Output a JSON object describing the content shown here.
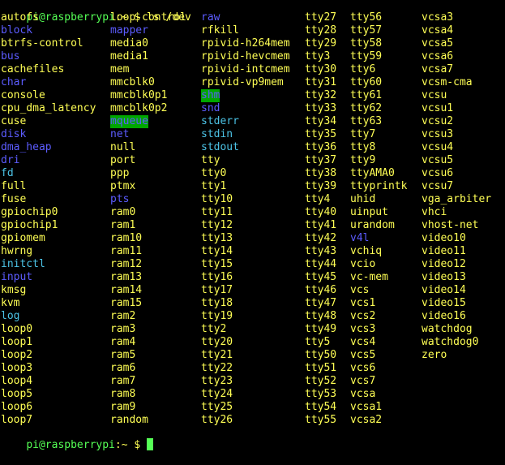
{
  "terminal": {
    "prompt": {
      "user_host": "pi@raspberrypi",
      "separator": ":",
      "path": "~",
      "symbol": "$"
    },
    "command": "ls /dev",
    "columns": [
      [
        {
          "name": "autofs",
          "kind": "f"
        },
        {
          "name": "block",
          "kind": "d"
        },
        {
          "name": "btrfs-control",
          "kind": "f"
        },
        {
          "name": "bus",
          "kind": "d"
        },
        {
          "name": "cachefiles",
          "kind": "f"
        },
        {
          "name": "char",
          "kind": "d"
        },
        {
          "name": "console",
          "kind": "f"
        },
        {
          "name": "cpu_dma_latency",
          "kind": "f"
        },
        {
          "name": "cuse",
          "kind": "f"
        },
        {
          "name": "disk",
          "kind": "d"
        },
        {
          "name": "dma_heap",
          "kind": "d"
        },
        {
          "name": "dri",
          "kind": "d"
        },
        {
          "name": "fd",
          "kind": "l"
        },
        {
          "name": "full",
          "kind": "f"
        },
        {
          "name": "fuse",
          "kind": "f"
        },
        {
          "name": "gpiochip0",
          "kind": "f"
        },
        {
          "name": "gpiochip1",
          "kind": "f"
        },
        {
          "name": "gpiomem",
          "kind": "f"
        },
        {
          "name": "hwrng",
          "kind": "f"
        },
        {
          "name": "initctl",
          "kind": "l"
        },
        {
          "name": "input",
          "kind": "d"
        },
        {
          "name": "kmsg",
          "kind": "f"
        },
        {
          "name": "kvm",
          "kind": "f"
        },
        {
          "name": "log",
          "kind": "l"
        },
        {
          "name": "loop0",
          "kind": "f"
        },
        {
          "name": "loop1",
          "kind": "f"
        },
        {
          "name": "loop2",
          "kind": "f"
        },
        {
          "name": "loop3",
          "kind": "f"
        },
        {
          "name": "loop4",
          "kind": "f"
        },
        {
          "name": "loop5",
          "kind": "f"
        },
        {
          "name": "loop6",
          "kind": "f"
        },
        {
          "name": "loop7",
          "kind": "f"
        }
      ],
      [
        {
          "name": "loop-control",
          "kind": "f"
        },
        {
          "name": "mapper",
          "kind": "d"
        },
        {
          "name": "media0",
          "kind": "f"
        },
        {
          "name": "media1",
          "kind": "f"
        },
        {
          "name": "mem",
          "kind": "f"
        },
        {
          "name": "mmcblk0",
          "kind": "f"
        },
        {
          "name": "mmcblk0p1",
          "kind": "f"
        },
        {
          "name": "mmcblk0p2",
          "kind": "f"
        },
        {
          "name": "mqueue",
          "kind": "hl"
        },
        {
          "name": "net",
          "kind": "d"
        },
        {
          "name": "null",
          "kind": "f"
        },
        {
          "name": "port",
          "kind": "f"
        },
        {
          "name": "ppp",
          "kind": "f"
        },
        {
          "name": "ptmx",
          "kind": "f"
        },
        {
          "name": "pts",
          "kind": "d"
        },
        {
          "name": "ram0",
          "kind": "f"
        },
        {
          "name": "ram1",
          "kind": "f"
        },
        {
          "name": "ram10",
          "kind": "f"
        },
        {
          "name": "ram11",
          "kind": "f"
        },
        {
          "name": "ram12",
          "kind": "f"
        },
        {
          "name": "ram13",
          "kind": "f"
        },
        {
          "name": "ram14",
          "kind": "f"
        },
        {
          "name": "ram15",
          "kind": "f"
        },
        {
          "name": "ram2",
          "kind": "f"
        },
        {
          "name": "ram3",
          "kind": "f"
        },
        {
          "name": "ram4",
          "kind": "f"
        },
        {
          "name": "ram5",
          "kind": "f"
        },
        {
          "name": "ram6",
          "kind": "f"
        },
        {
          "name": "ram7",
          "kind": "f"
        },
        {
          "name": "ram8",
          "kind": "f"
        },
        {
          "name": "ram9",
          "kind": "f"
        },
        {
          "name": "random",
          "kind": "f"
        }
      ],
      [
        {
          "name": "raw",
          "kind": "d"
        },
        {
          "name": "rfkill",
          "kind": "f"
        },
        {
          "name": "rpivid-h264mem",
          "kind": "f"
        },
        {
          "name": "rpivid-hevcmem",
          "kind": "f"
        },
        {
          "name": "rpivid-intcmem",
          "kind": "f"
        },
        {
          "name": "rpivid-vp9mem",
          "kind": "f"
        },
        {
          "name": "shm",
          "kind": "hl"
        },
        {
          "name": "snd",
          "kind": "d"
        },
        {
          "name": "stderr",
          "kind": "l"
        },
        {
          "name": "stdin",
          "kind": "l"
        },
        {
          "name": "stdout",
          "kind": "l"
        },
        {
          "name": "tty",
          "kind": "f"
        },
        {
          "name": "tty0",
          "kind": "f"
        },
        {
          "name": "tty1",
          "kind": "f"
        },
        {
          "name": "tty10",
          "kind": "f"
        },
        {
          "name": "tty11",
          "kind": "f"
        },
        {
          "name": "tty12",
          "kind": "f"
        },
        {
          "name": "tty13",
          "kind": "f"
        },
        {
          "name": "tty14",
          "kind": "f"
        },
        {
          "name": "tty15",
          "kind": "f"
        },
        {
          "name": "tty16",
          "kind": "f"
        },
        {
          "name": "tty17",
          "kind": "f"
        },
        {
          "name": "tty18",
          "kind": "f"
        },
        {
          "name": "tty19",
          "kind": "f"
        },
        {
          "name": "tty2",
          "kind": "f"
        },
        {
          "name": "tty20",
          "kind": "f"
        },
        {
          "name": "tty21",
          "kind": "f"
        },
        {
          "name": "tty22",
          "kind": "f"
        },
        {
          "name": "tty23",
          "kind": "f"
        },
        {
          "name": "tty24",
          "kind": "f"
        },
        {
          "name": "tty25",
          "kind": "f"
        },
        {
          "name": "tty26",
          "kind": "f"
        }
      ],
      [
        {
          "name": "tty27",
          "kind": "f"
        },
        {
          "name": "tty28",
          "kind": "f"
        },
        {
          "name": "tty29",
          "kind": "f"
        },
        {
          "name": "tty3",
          "kind": "f"
        },
        {
          "name": "tty30",
          "kind": "f"
        },
        {
          "name": "tty31",
          "kind": "f"
        },
        {
          "name": "tty32",
          "kind": "f"
        },
        {
          "name": "tty33",
          "kind": "f"
        },
        {
          "name": "tty34",
          "kind": "f"
        },
        {
          "name": "tty35",
          "kind": "f"
        },
        {
          "name": "tty36",
          "kind": "f"
        },
        {
          "name": "tty37",
          "kind": "f"
        },
        {
          "name": "tty38",
          "kind": "f"
        },
        {
          "name": "tty39",
          "kind": "f"
        },
        {
          "name": "tty4",
          "kind": "f"
        },
        {
          "name": "tty40",
          "kind": "f"
        },
        {
          "name": "tty41",
          "kind": "f"
        },
        {
          "name": "tty42",
          "kind": "f"
        },
        {
          "name": "tty43",
          "kind": "f"
        },
        {
          "name": "tty44",
          "kind": "f"
        },
        {
          "name": "tty45",
          "kind": "f"
        },
        {
          "name": "tty46",
          "kind": "f"
        },
        {
          "name": "tty47",
          "kind": "f"
        },
        {
          "name": "tty48",
          "kind": "f"
        },
        {
          "name": "tty49",
          "kind": "f"
        },
        {
          "name": "tty5",
          "kind": "f"
        },
        {
          "name": "tty50",
          "kind": "f"
        },
        {
          "name": "tty51",
          "kind": "f"
        },
        {
          "name": "tty52",
          "kind": "f"
        },
        {
          "name": "tty53",
          "kind": "f"
        },
        {
          "name": "tty54",
          "kind": "f"
        },
        {
          "name": "tty55",
          "kind": "f"
        }
      ],
      [
        {
          "name": "tty56",
          "kind": "f"
        },
        {
          "name": "tty57",
          "kind": "f"
        },
        {
          "name": "tty58",
          "kind": "f"
        },
        {
          "name": "tty59",
          "kind": "f"
        },
        {
          "name": "tty6",
          "kind": "f"
        },
        {
          "name": "tty60",
          "kind": "f"
        },
        {
          "name": "tty61",
          "kind": "f"
        },
        {
          "name": "tty62",
          "kind": "f"
        },
        {
          "name": "tty63",
          "kind": "f"
        },
        {
          "name": "tty7",
          "kind": "f"
        },
        {
          "name": "tty8",
          "kind": "f"
        },
        {
          "name": "tty9",
          "kind": "f"
        },
        {
          "name": "ttyAMA0",
          "kind": "f"
        },
        {
          "name": "ttyprintk",
          "kind": "f"
        },
        {
          "name": "uhid",
          "kind": "f"
        },
        {
          "name": "uinput",
          "kind": "f"
        },
        {
          "name": "urandom",
          "kind": "f"
        },
        {
          "name": "v4l",
          "kind": "d"
        },
        {
          "name": "vchiq",
          "kind": "f"
        },
        {
          "name": "vcio",
          "kind": "f"
        },
        {
          "name": "vc-mem",
          "kind": "f"
        },
        {
          "name": "vcs",
          "kind": "f"
        },
        {
          "name": "vcs1",
          "kind": "f"
        },
        {
          "name": "vcs2",
          "kind": "f"
        },
        {
          "name": "vcs3",
          "kind": "f"
        },
        {
          "name": "vcs4",
          "kind": "f"
        },
        {
          "name": "vcs5",
          "kind": "f"
        },
        {
          "name": "vcs6",
          "kind": "f"
        },
        {
          "name": "vcs7",
          "kind": "f"
        },
        {
          "name": "vcsa",
          "kind": "f"
        },
        {
          "name": "vcsa1",
          "kind": "f"
        },
        {
          "name": "vcsa2",
          "kind": "f"
        }
      ],
      [
        {
          "name": "vcsa3",
          "kind": "f"
        },
        {
          "name": "vcsa4",
          "kind": "f"
        },
        {
          "name": "vcsa5",
          "kind": "f"
        },
        {
          "name": "vcsa6",
          "kind": "f"
        },
        {
          "name": "vcsa7",
          "kind": "f"
        },
        {
          "name": "vcsm-cma",
          "kind": "f"
        },
        {
          "name": "vcsu",
          "kind": "f"
        },
        {
          "name": "vcsu1",
          "kind": "f"
        },
        {
          "name": "vcsu2",
          "kind": "f"
        },
        {
          "name": "vcsu3",
          "kind": "f"
        },
        {
          "name": "vcsu4",
          "kind": "f"
        },
        {
          "name": "vcsu5",
          "kind": "f"
        },
        {
          "name": "vcsu6",
          "kind": "f"
        },
        {
          "name": "vcsu7",
          "kind": "f"
        },
        {
          "name": "vga_arbiter",
          "kind": "f"
        },
        {
          "name": "vhci",
          "kind": "f"
        },
        {
          "name": "vhost-net",
          "kind": "f"
        },
        {
          "name": "video10",
          "kind": "f"
        },
        {
          "name": "video11",
          "kind": "f"
        },
        {
          "name": "video12",
          "kind": "f"
        },
        {
          "name": "video13",
          "kind": "f"
        },
        {
          "name": "video14",
          "kind": "f"
        },
        {
          "name": "video15",
          "kind": "f"
        },
        {
          "name": "video16",
          "kind": "f"
        },
        {
          "name": "watchdog",
          "kind": "f"
        },
        {
          "name": "watchdog0",
          "kind": "f"
        },
        {
          "name": "zero",
          "kind": "f"
        }
      ]
    ]
  },
  "colors": {
    "background": "#000000",
    "prompt_user_host": "#55ff55",
    "file_text": "#ffff55",
    "directory_text": "#5c5cff",
    "symlink_text": "#4cc3e6",
    "sticky_dir_background": "#00a600",
    "cursor": "#55ff55"
  }
}
